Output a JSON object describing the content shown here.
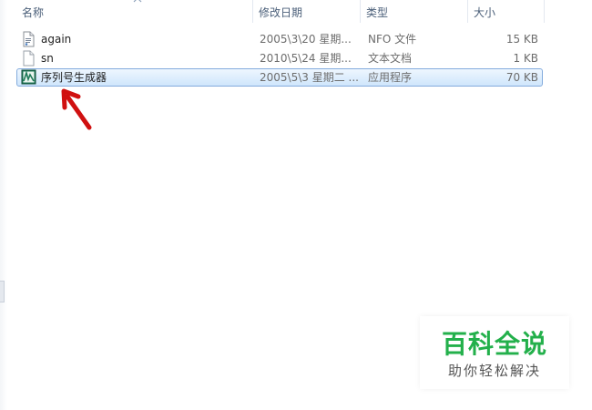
{
  "columns": {
    "name": "名称",
    "date": "修改日期",
    "type": "类型",
    "size": "大小"
  },
  "sort_indicator": "name-column-ascending",
  "files": [
    {
      "name": "again",
      "date": "2005\\3\\20 星期...",
      "type": "NFO 文件",
      "size": "15 KB",
      "icon": "nfo-file-icon",
      "selected": false
    },
    {
      "name": "sn",
      "date": "2010\\5\\24 星期...",
      "type": "文本文档",
      "size": "1 KB",
      "icon": "text-file-icon",
      "selected": false
    },
    {
      "name": "序列号生成器",
      "date": "2005\\5\\3 星期二 ...",
      "type": "应用程序",
      "size": "70 KB",
      "icon": "application-icon",
      "selected": true
    }
  ],
  "annotation": {
    "icon": "red-arrow-icon",
    "color": "#d01010"
  },
  "watermark": {
    "title": "百科全说",
    "subtitle": "助你轻松解决",
    "title_color": "#23b04b"
  },
  "colors": {
    "header_text": "#4c607a",
    "selection_border": "#84acdd",
    "selection_fill": "#cfe6fc"
  }
}
